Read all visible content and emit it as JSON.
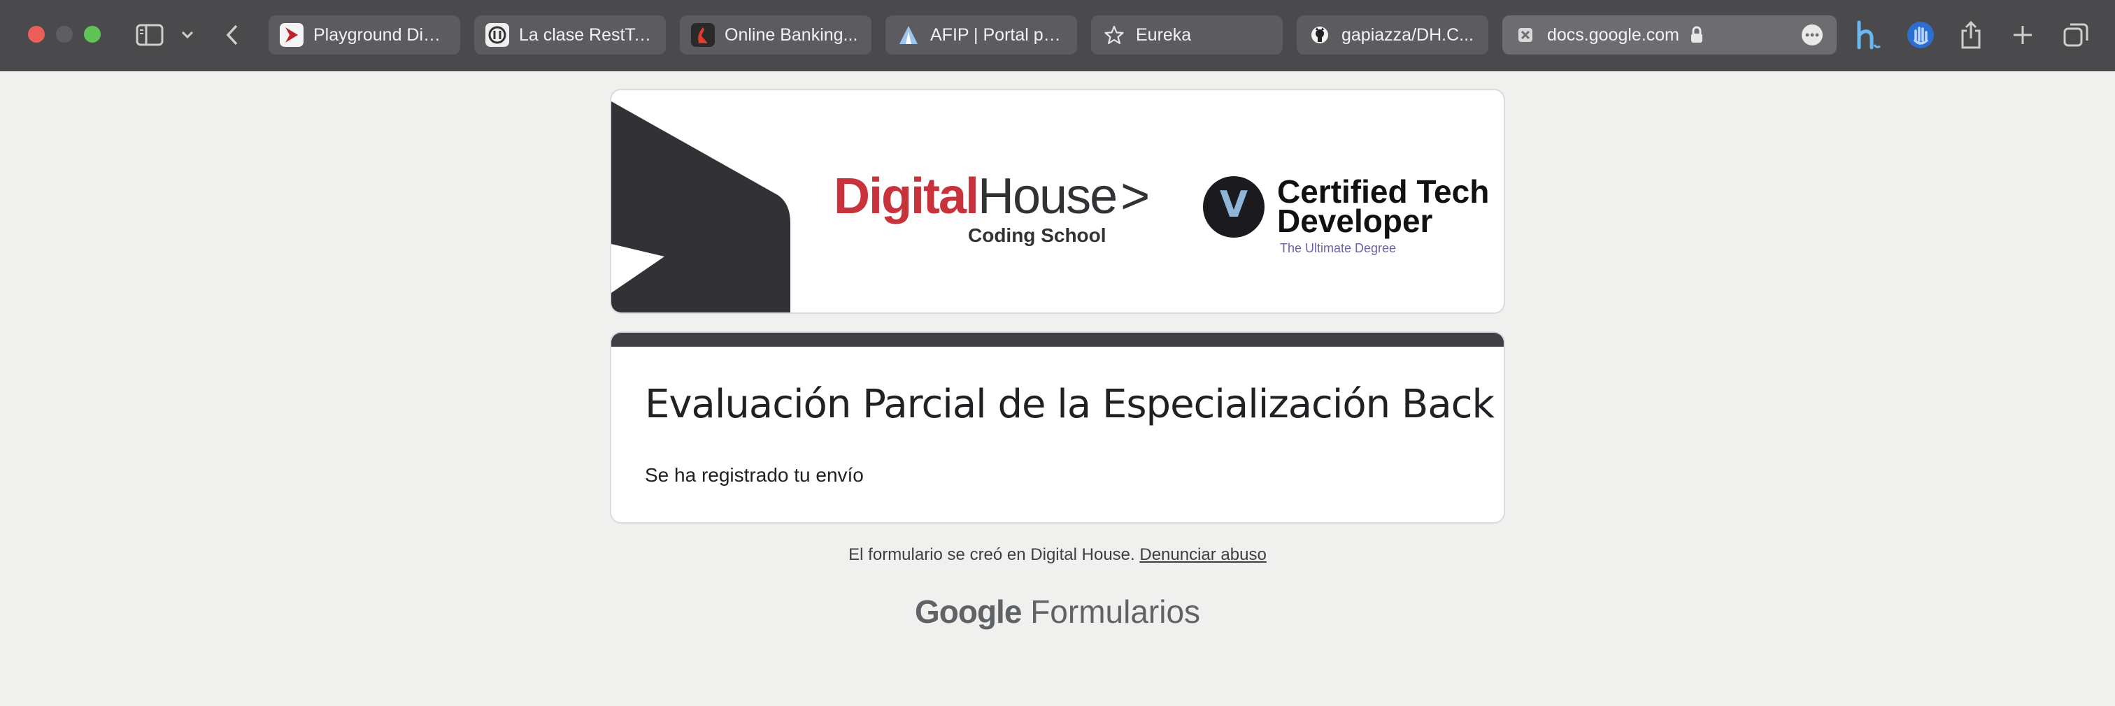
{
  "browser": {
    "tabs": [
      {
        "label": "Playground Digi...",
        "icon": "digitalhouse-favicon",
        "color": "#c0202a"
      },
      {
        "label": "La clase RestTe...",
        "icon": "webinar-favicon",
        "color": "#2b2b2b"
      },
      {
        "label": "Online Banking...",
        "icon": "santander-favicon",
        "color": "#c62a22"
      },
      {
        "label": "AFIP | Portal pri...",
        "icon": "afip-favicon",
        "color": "#1f6fb8"
      },
      {
        "label": "Eureka",
        "icon": "star-icon",
        "color": "#dddddd"
      },
      {
        "label": "gapiazza/DH.C...",
        "icon": "github-icon",
        "color": "#111111"
      }
    ],
    "active_tab": {
      "label": "docs.google.com",
      "icon": "google-forms-favicon"
    }
  },
  "banner": {
    "logo_left_word": "Digital",
    "logo_right_word": "House",
    "logo_arrow": ">",
    "logo_sub": "Coding School",
    "ctd_line1": "Certified Tech",
    "ctd_line2": "Developer",
    "ctd_tagline": "The Ultimate Degree",
    "ctd_badge": "V",
    "colors": {
      "brand_red": "#c8323a",
      "dark": "#323236",
      "purple": "#6f61a9"
    }
  },
  "form": {
    "title": "Evaluación Parcial de la Especialización Back End I",
    "confirmation": "Se ha registrado tu envío"
  },
  "footer": {
    "created_text": "El formulario se creó en Digital House.",
    "report_link": "Denunciar abuso",
    "brand_google": "Google",
    "brand_forms": "Formularios"
  }
}
